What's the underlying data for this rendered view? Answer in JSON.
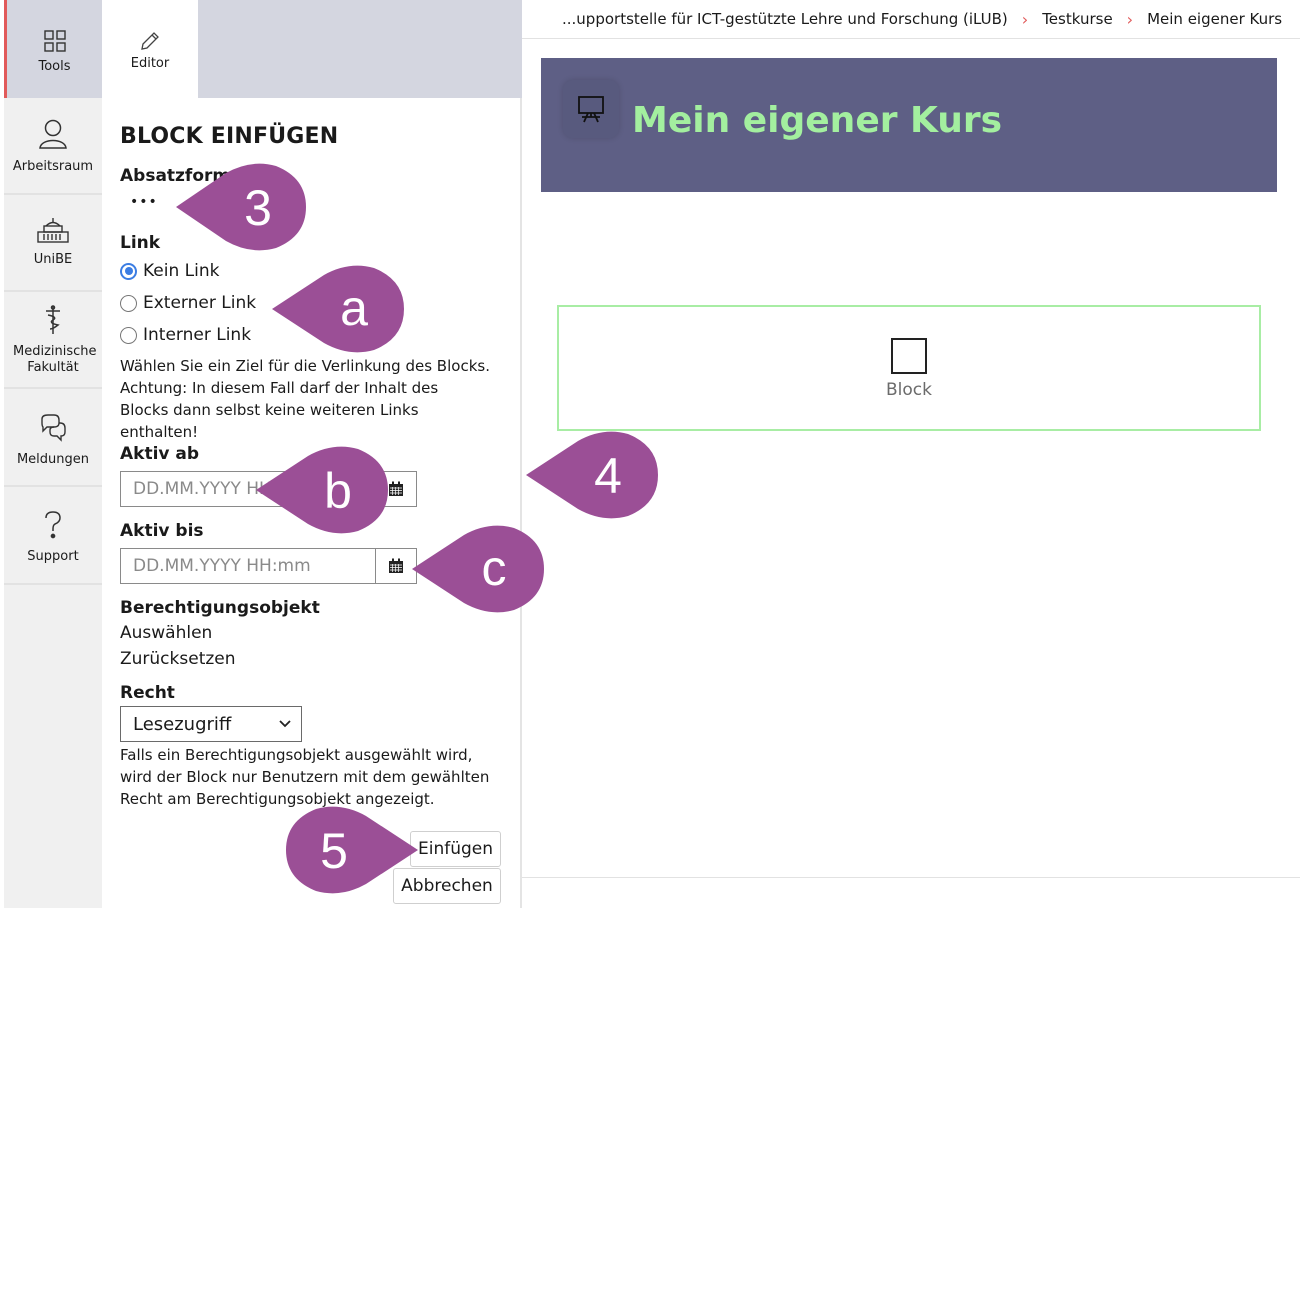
{
  "mainbar": {
    "items": [
      {
        "label": "Tools",
        "icon": "grid-icon"
      },
      {
        "label": "Arbeitsraum",
        "icon": "person-icon"
      },
      {
        "label": "UniBE",
        "icon": "building-icon"
      },
      {
        "label": "Medizinische Fakultät",
        "icon": "caduceus-icon"
      },
      {
        "label": "Meldungen",
        "icon": "chat-icon"
      },
      {
        "label": "Support",
        "icon": "question-icon"
      }
    ]
  },
  "toolpanel": {
    "tab_label": "Editor",
    "title": "BLOCK EINFÜGEN",
    "absatzformat": {
      "label": "Absatzformat",
      "value": "•••"
    },
    "link": {
      "label": "Link",
      "options": [
        "Kein Link",
        "Externer Link",
        "Interner Link"
      ],
      "selected": "Kein Link",
      "help": "Wählen Sie ein Ziel für die Verlinkung des Blocks. Achtung: In diesem Fall darf der Inhalt des Blocks dann selbst keine weiteren Links enthalten!"
    },
    "aktiv_ab": {
      "label": "Aktiv ab",
      "placeholder": "DD.MM.YYYY HH:mm"
    },
    "aktiv_bis": {
      "label": "Aktiv bis",
      "placeholder": "DD.MM.YYYY HH:mm"
    },
    "berechtigung": {
      "label": "Berechtigungsobjekt",
      "select_link": "Auswählen",
      "reset_link": "Zurücksetzen"
    },
    "recht": {
      "label": "Recht",
      "selected": "Lesezugriff",
      "help": "Falls ein Berechtigungsobjekt ausgewählt wird, wird der Block nur Benutzern mit dem gewählten Recht am Berechtigungsobjekt angezeigt."
    },
    "buttons": {
      "insert": "Einfügen",
      "cancel": "Abbrechen"
    }
  },
  "breadcrumb": [
    "...upportstelle für ICT-gestützte Lehre und Forschung (iLUB)",
    "Testkurse",
    "Mein eigener Kurs"
  ],
  "course": {
    "title": "Mein eigener Kurs",
    "icon": "presentation-board-icon"
  },
  "block": {
    "label": "Block"
  },
  "callouts": [
    "3",
    "a",
    "b",
    "c",
    "4",
    "5"
  ],
  "colors": {
    "accent": "#e15a5a",
    "header_bg": "#5e5f85",
    "title_green": "#a3ef9f",
    "callout": "#9b4f96",
    "radio_blue": "#3b7de3"
  }
}
